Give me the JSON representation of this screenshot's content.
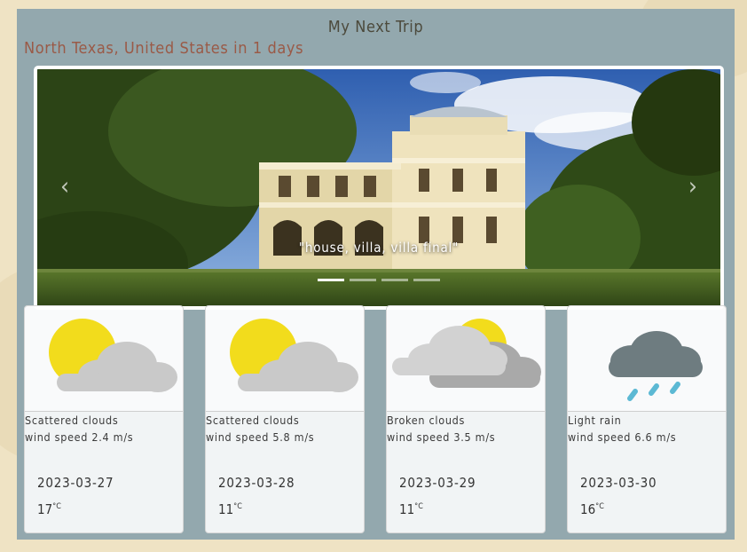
{
  "page": {
    "title": "My Next Trip",
    "destination": "North Texas, United States in 1 days"
  },
  "carousel": {
    "caption": "\"house, villa, villa final\"",
    "prev_icon": "chevron-left-icon",
    "next_icon": "chevron-right-icon",
    "prev_glyph": "‹",
    "next_glyph": "›",
    "slide_count": 4,
    "active_slide": 1
  },
  "forecast": [
    {
      "icon": "partly-cloudy-icon",
      "description": "Scattered clouds",
      "wind": "wind speed 2.4 m/s",
      "date": "2023-03-27",
      "temp": "17",
      "unit": "°C"
    },
    {
      "icon": "partly-cloudy-icon",
      "description": "Scattered clouds",
      "wind": "wind speed 5.8 m/s",
      "date": "2023-03-28",
      "temp": "11",
      "unit": "°C"
    },
    {
      "icon": "broken-clouds-icon",
      "description": "Broken clouds",
      "wind": "wind speed 3.5 m/s",
      "date": "2023-03-29",
      "temp": "11",
      "unit": "°C"
    },
    {
      "icon": "light-rain-icon",
      "description": "Light rain",
      "wind": "wind speed 6.6 m/s",
      "date": "2023-03-30",
      "temp": "16",
      "unit": "°C"
    }
  ],
  "colors": {
    "panel": "#93a8ae",
    "title": "#4c4a3c",
    "destination": "#9a5a47",
    "sun": "#f2dc1c",
    "cloud": "#c9c9c9",
    "rain_cloud": "#6e7c80",
    "rain_drop": "#5cb9d4"
  }
}
